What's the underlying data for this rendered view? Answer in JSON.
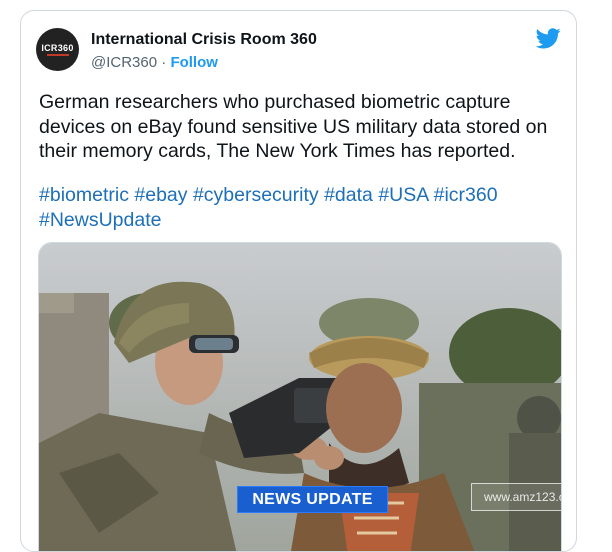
{
  "author": {
    "avatar_text": "ICR360",
    "name": "International Crisis Room 360",
    "handle": "@ICR360",
    "separator": "·",
    "follow_label": "Follow"
  },
  "tweet": {
    "text": "German researchers who purchased biometric capture devices on eBay found sensitive US military data stored on their memory cards, The New York Times has reported.",
    "hashtags": [
      "#biometric",
      "#ebay",
      "#cybersecurity",
      "#data",
      "#USA",
      "#icr360",
      "#NewsUpdate"
    ]
  },
  "media": {
    "banner_text": "NEWS UPDATE",
    "watermark_text": "www.amz123.c"
  },
  "colors": {
    "link_blue": "#1d6fb8",
    "twitter_blue": "#1d9bf0",
    "banner_blue": "#1a5fd0"
  }
}
